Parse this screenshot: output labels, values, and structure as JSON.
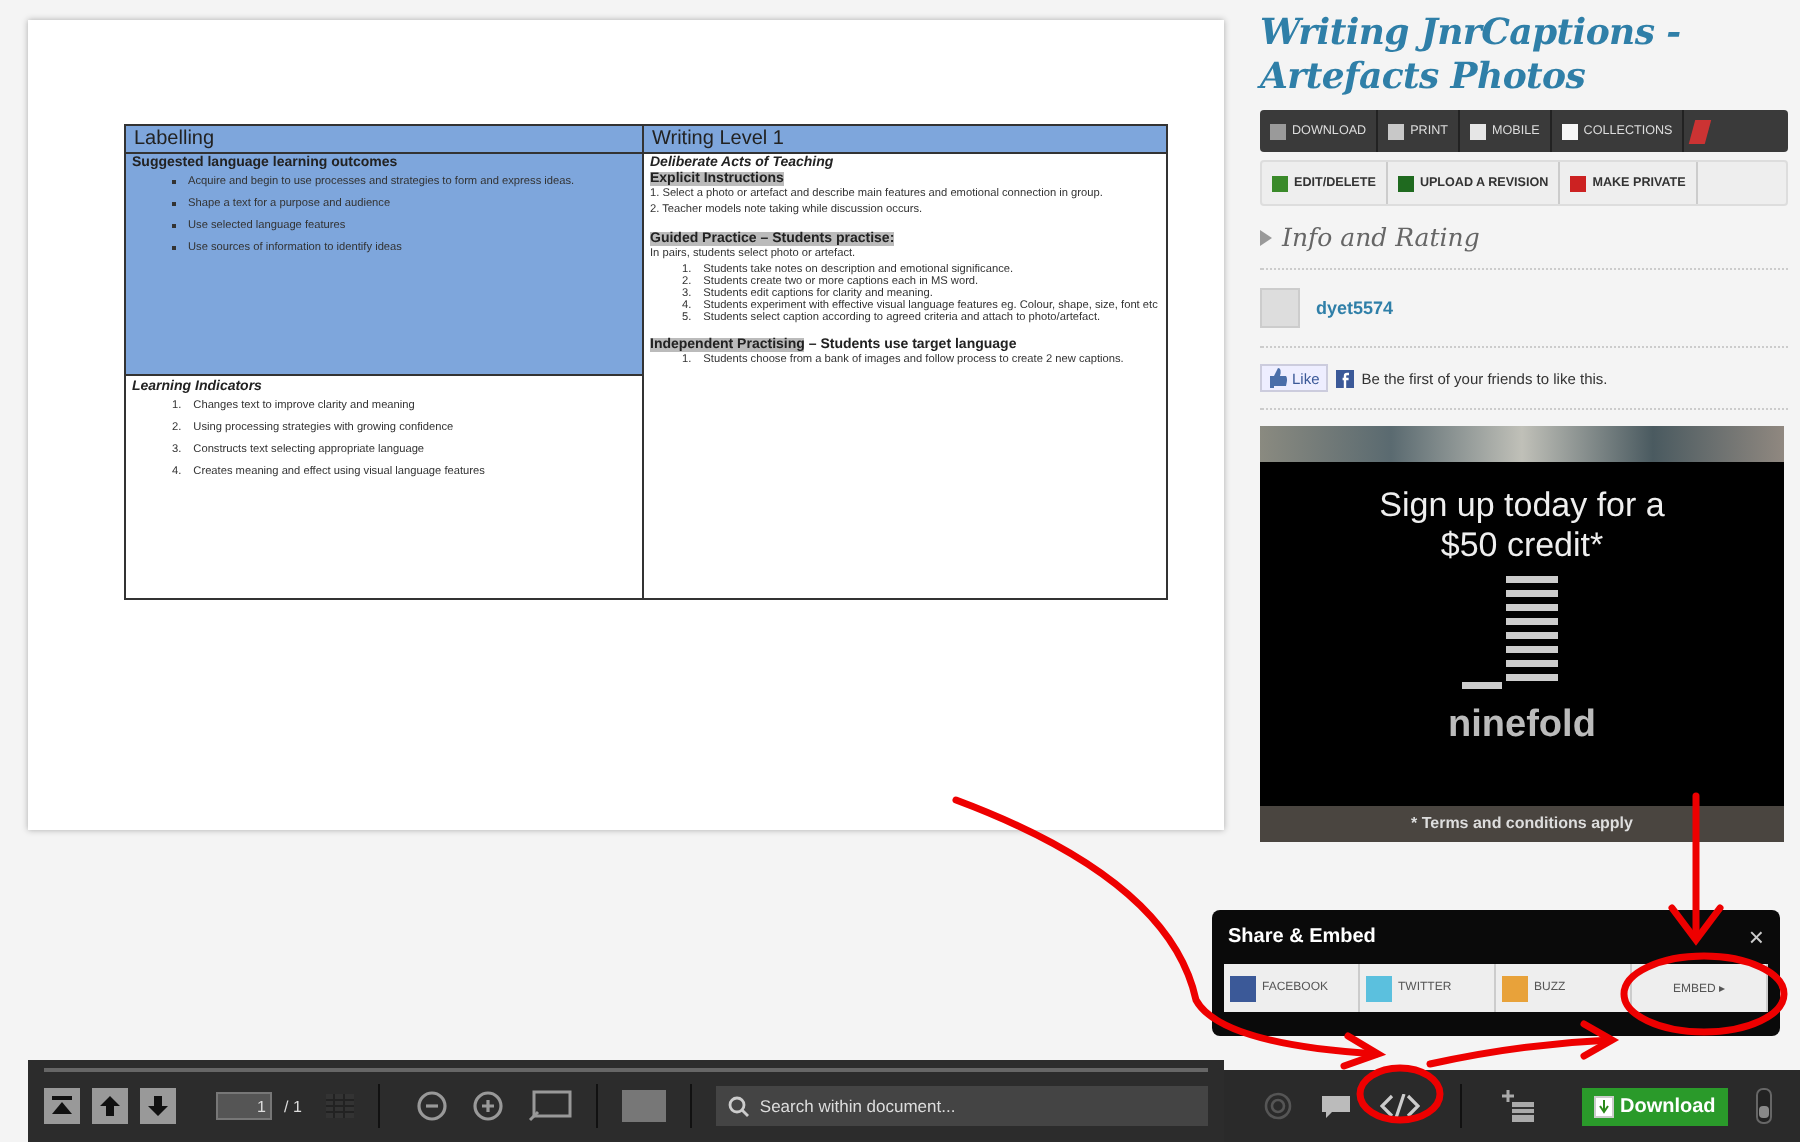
{
  "document": {
    "left": {
      "heading": "Labelling",
      "outcomes_title": "Suggested language learning outcomes",
      "outcomes": [
        "Acquire and begin to use processes and strategies to form and express ideas.",
        "Shape a text for a purpose and audience",
        "Use selected language features",
        "Use sources of information to identify ideas"
      ],
      "indicators_title": "Learning Indicators",
      "indicators": [
        {
          "marker": "1.",
          "text": "Changes text to improve clarity and meaning"
        },
        {
          "marker": "2.",
          "text": "Using processing strategies with growing confidence"
        },
        {
          "marker": "3.",
          "text": "Constructs text selecting appropriate language"
        },
        {
          "marker": "4.",
          "text": "Creates meaning and effect using visual language features"
        }
      ]
    },
    "right": {
      "heading": "Writing Level 1",
      "subtitle": "Deliberate Acts of Teaching",
      "explicit_title": "Explicit Instructions",
      "explicit_lines": [
        "1. Select a photo or artefact and describe main features and emotional connection in group.",
        "2. Teacher models note taking while discussion occurs."
      ],
      "guided_title": "Guided Practice – Students practise:",
      "guided_intro": "In pairs, students select photo or artefact.",
      "guided_steps": [
        {
          "marker": "1.",
          "text": "Students take notes on description and emotional significance."
        },
        {
          "marker": "2.",
          "text": "Students create two or more captions each in MS word."
        },
        {
          "marker": "3.",
          "text": "Students edit captions for clarity and meaning."
        },
        {
          "marker": "4.",
          "text": "Students experiment with effective visual language features eg. Colour, shape, size, font etc"
        },
        {
          "marker": "5.",
          "text": "Students select caption according to agreed criteria and attach to photo/artefact."
        }
      ],
      "independent_title": {
        "highlight": "Independent Practising",
        "rest": "– Students use target language"
      },
      "independent_steps": [
        {
          "marker": "1.",
          "text": "Students choose from a bank of images and follow process to create 2 new captions."
        }
      ]
    }
  },
  "sidebar": {
    "title": "Writing JnrCaptions - Artefacts Photos",
    "actions": [
      {
        "kind": "download",
        "label": "DOWNLOAD"
      },
      {
        "kind": "print",
        "label": "PRINT"
      },
      {
        "kind": "mobile",
        "label": "MOBILE"
      },
      {
        "kind": "collections",
        "label": "COLLECTIONS"
      }
    ],
    "owner_actions": [
      {
        "kind": "edit",
        "label": "EDIT/DELETE"
      },
      {
        "kind": "upload",
        "label": "UPLOAD A REVISION"
      },
      {
        "kind": "private",
        "label": "MAKE PRIVATE"
      }
    ],
    "info_heading": "Info and Rating",
    "user": "dyet5574",
    "like_button": "Like",
    "like_text": "Be the first of your friends to like this.",
    "ad": {
      "headline": "Sign up today for a $50 credit*",
      "brand": "ninefold",
      "terms": "* Terms and conditions apply"
    }
  },
  "share_popup": {
    "title": "Share & Embed",
    "close": "×",
    "options": [
      {
        "kind": "facebook",
        "label": "FACEBOOK"
      },
      {
        "kind": "twitter",
        "label": "TWITTER"
      },
      {
        "kind": "buzz",
        "label": "BUZZ"
      },
      {
        "kind": "embed",
        "label": "EMBED ▸"
      }
    ]
  },
  "toolbar": {
    "page_number": "1",
    "page_total": "/ 1",
    "search_placeholder": "Search within document...",
    "download": "Download"
  }
}
